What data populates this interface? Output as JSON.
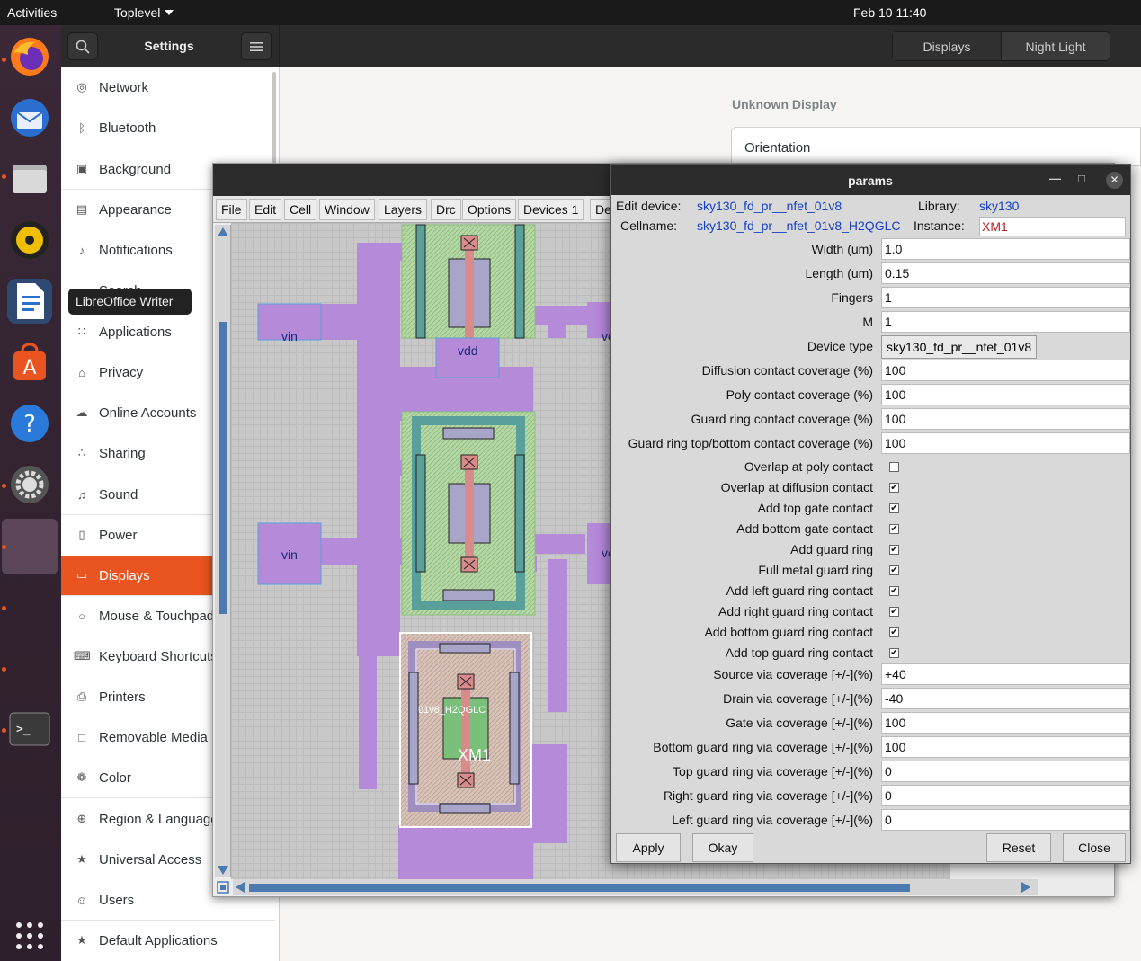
{
  "topbar": {
    "activities": "Activities",
    "app_menu": "Toplevel",
    "clock": "Feb 10  11:40"
  },
  "dock": {
    "tooltip": "LibreOffice Writer"
  },
  "settings": {
    "title": "Settings",
    "tabs": [
      "Displays",
      "Night Light"
    ],
    "sidebar": [
      {
        "label": "Network",
        "icon": "network-icon"
      },
      {
        "label": "Bluetooth",
        "icon": "bluetooth-icon"
      },
      {
        "label": "Background",
        "icon": "background-icon"
      },
      {
        "label": "Appearance",
        "icon": "appearance-icon"
      },
      {
        "label": "Notifications",
        "icon": "bell-icon"
      },
      {
        "label": "Search",
        "icon": "search-icon"
      },
      {
        "label": "Applications",
        "icon": "grid-icon"
      },
      {
        "label": "Privacy",
        "icon": "lock-icon"
      },
      {
        "label": "Online Accounts",
        "icon": "cloud-icon"
      },
      {
        "label": "Sharing",
        "icon": "share-icon"
      },
      {
        "label": "Sound",
        "icon": "music-note-icon"
      },
      {
        "label": "Power",
        "icon": "battery-icon"
      },
      {
        "label": "Displays",
        "icon": "display-icon"
      },
      {
        "label": "Mouse & Touchpad",
        "icon": "mouse-icon"
      },
      {
        "label": "Keyboard Shortcuts",
        "icon": "keyboard-icon"
      },
      {
        "label": "Printers",
        "icon": "printer-icon"
      },
      {
        "label": "Removable Media",
        "icon": "media-icon"
      },
      {
        "label": "Color",
        "icon": "color-icon"
      },
      {
        "label": "Region & Language",
        "icon": "globe-icon"
      },
      {
        "label": "Universal Access",
        "icon": "accessibility-icon"
      },
      {
        "label": "Users",
        "icon": "users-icon"
      },
      {
        "label": "Default Applications",
        "icon": "star-icon"
      }
    ],
    "selected": "Displays",
    "display_name": "Unknown Display",
    "orientation_label": "Orientation"
  },
  "layout_window": {
    "menus": [
      "File",
      "Edit",
      "Cell",
      "Window",
      "Layers",
      "Drc",
      "Options",
      "Devices 1",
      "De"
    ],
    "labels": {
      "vin_top": "vin",
      "vdd": "vdd",
      "vin_mid": "vin",
      "ve_top": "ve",
      "ve_mid": "ve",
      "cellname": "01v8_H2QGLC",
      "instance": "XM1"
    }
  },
  "params": {
    "title": "params",
    "edit_device_label": "Edit device:",
    "edit_device": "sky130_fd_pr__nfet_01v8",
    "library_label": "Library:",
    "library": "sky130",
    "cellname_label": "Cellname:",
    "cellname": "sky130_fd_pr__nfet_01v8_H2QGLC",
    "instance_label": "Instance:",
    "instance": "XM1",
    "entries_top": [
      {
        "label": "Width (um)",
        "value": "1.0"
      },
      {
        "label": "Length (um)",
        "value": "0.15"
      },
      {
        "label": "Fingers",
        "value": "1"
      },
      {
        "label": "M",
        "value": "1"
      }
    ],
    "device_type_label": "Device type",
    "device_type": "sky130_fd_pr__nfet_01v8",
    "entries_cov": [
      {
        "label": "Diffusion contact coverage (%)",
        "value": "100"
      },
      {
        "label": "Poly contact coverage (%)",
        "value": "100"
      },
      {
        "label": "Guard ring contact coverage (%)",
        "value": "100"
      },
      {
        "label": "Guard ring top/bottom contact coverage (%)",
        "value": "100"
      }
    ],
    "checks": [
      {
        "label": "Overlap at poly contact",
        "checked": false
      },
      {
        "label": "Overlap at diffusion contact",
        "checked": true
      },
      {
        "label": "Add top gate contact",
        "checked": true
      },
      {
        "label": "Add bottom gate contact",
        "checked": true
      },
      {
        "label": "Add guard ring",
        "checked": true
      },
      {
        "label": "Full metal guard ring",
        "checked": true
      },
      {
        "label": "Add left guard ring contact",
        "checked": true
      },
      {
        "label": "Add right guard ring contact",
        "checked": true
      },
      {
        "label": "Add bottom guard ring contact",
        "checked": true
      },
      {
        "label": "Add top guard ring contact",
        "checked": true
      }
    ],
    "entries_via": [
      {
        "label": "Source via coverage [+/-](%)",
        "value": "+40"
      },
      {
        "label": "Drain via coverage [+/-](%)",
        "value": "-40"
      },
      {
        "label": "Gate via coverage [+/-](%)",
        "value": "100"
      },
      {
        "label": "Bottom guard ring via coverage [+/-](%)",
        "value": "100"
      },
      {
        "label": "Top guard ring via coverage [+/-](%)",
        "value": "0"
      },
      {
        "label": "Right guard ring via coverage [+/-](%)",
        "value": "0"
      },
      {
        "label": "Left guard ring via coverage [+/-](%)",
        "value": "0"
      }
    ],
    "buttons": {
      "apply": "Apply",
      "okay": "Okay",
      "reset": "Reset",
      "close": "Close"
    }
  },
  "colors": {
    "accent": "#e95420",
    "link": "#1640c8",
    "metal": "#b58ad9",
    "poly": "#d98a8a",
    "diff": "#7ac07a"
  }
}
